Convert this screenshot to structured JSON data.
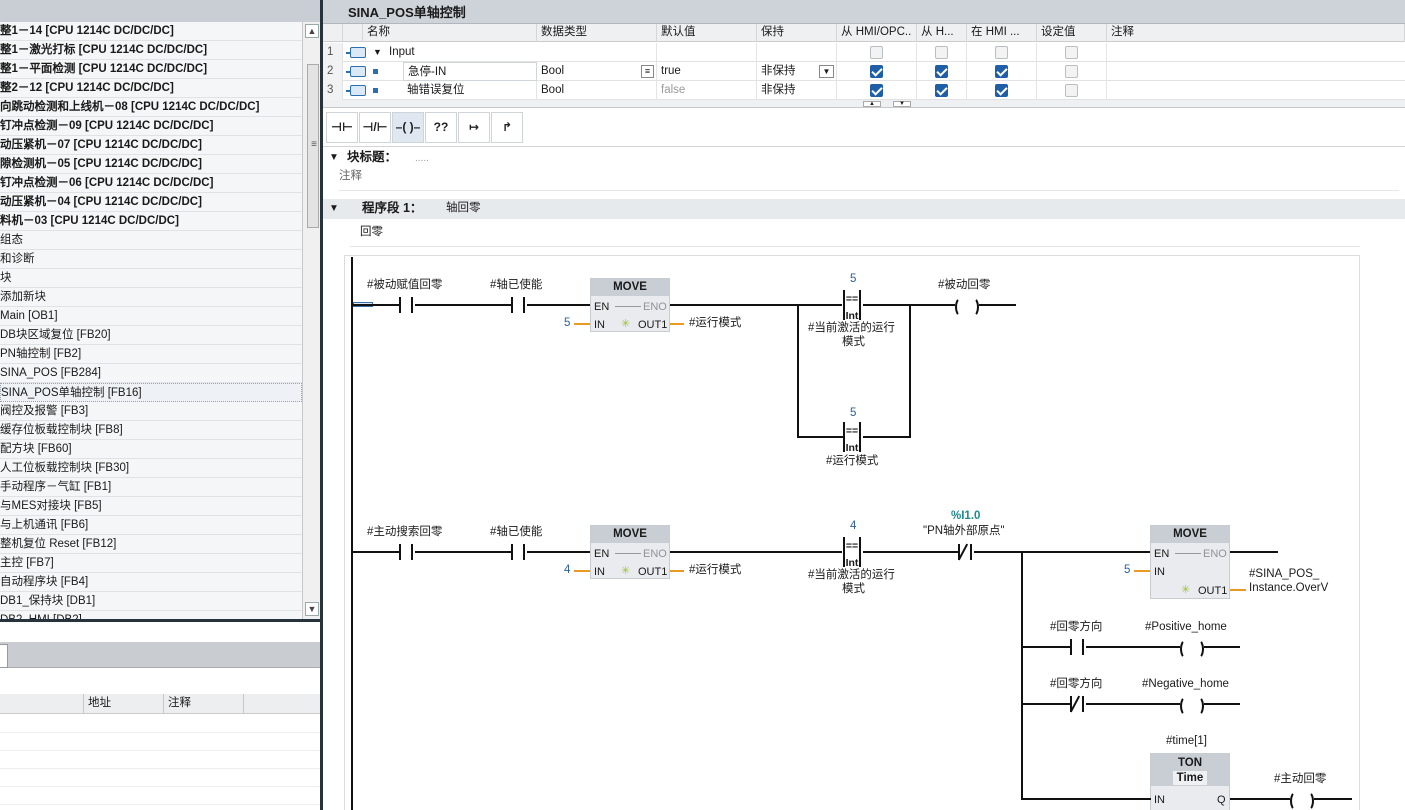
{
  "tree": {
    "items": [
      {
        "label": "整1－14 [CPU 1214C DC/DC/DC]",
        "type": "device"
      },
      {
        "label": "整1－激光打标 [CPU 1214C DC/DC/DC]",
        "type": "device"
      },
      {
        "label": "整1－平面检测 [CPU 1214C DC/DC/DC]",
        "type": "device"
      },
      {
        "label": "整2－12 [CPU 1214C DC/DC/DC]",
        "type": "device"
      },
      {
        "label": "向跳动检测和上线机－08 [CPU 1214C DC/DC/DC]",
        "type": "device"
      },
      {
        "label": "钉冲点检测－09 [CPU 1214C DC/DC/DC]",
        "type": "device"
      },
      {
        "label": "动压紧机－07 [CPU 1214C DC/DC/DC]",
        "type": "device"
      },
      {
        "label": "隙检测机－05 [CPU 1214C DC/DC/DC]",
        "type": "device"
      },
      {
        "label": "钉冲点检测－06 [CPU 1214C DC/DC/DC]",
        "type": "device"
      },
      {
        "label": "动压紧机－04 [CPU 1214C DC/DC/DC]",
        "type": "device"
      },
      {
        "label": "料机－03 [CPU 1214C DC/DC/DC]",
        "type": "device"
      },
      {
        "label": "组态",
        "type": "item"
      },
      {
        "label": "和诊断",
        "type": "item"
      },
      {
        "label": "块",
        "type": "item"
      },
      {
        "label": "添加新块",
        "type": "item"
      },
      {
        "label": "Main [OB1]",
        "type": "item"
      },
      {
        "label": "DB块区域复位 [FB20]",
        "type": "item"
      },
      {
        "label": "PN轴控制 [FB2]",
        "type": "item"
      },
      {
        "label": "SINA_POS [FB284]",
        "type": "item"
      },
      {
        "label": "SINA_POS单轴控制 [FB16]",
        "type": "selected"
      },
      {
        "label": "阀控及报警 [FB3]",
        "type": "item"
      },
      {
        "label": "缓存位板载控制块 [FB8]",
        "type": "item"
      },
      {
        "label": "配方块 [FB60]",
        "type": "item"
      },
      {
        "label": "人工位板载控制块 [FB30]",
        "type": "item"
      },
      {
        "label": "手动程序－气缸 [FB1]",
        "type": "item"
      },
      {
        "label": "与MES对接块 [FB5]",
        "type": "item"
      },
      {
        "label": "与上机通讯 [FB6]",
        "type": "item"
      },
      {
        "label": "整机复位 Reset [FB12]",
        "type": "item"
      },
      {
        "label": "主控 [FB7]",
        "type": "item"
      },
      {
        "label": "自动程序块 [FB4]",
        "type": "item"
      },
      {
        "label": "DB1_保持块 [DB1]",
        "type": "item"
      },
      {
        "label": "DB2_HMI [DB2]",
        "type": "item"
      }
    ]
  },
  "lower": {
    "cols": [
      "地址",
      "注释"
    ]
  },
  "editor": {
    "title": "SINA_POS单轴控制",
    "columns": [
      "名称",
      "数据类型",
      "默认值",
      "保持",
      "从 HMI/OPC..",
      "从 H...",
      "在 HMI ...",
      "设定值",
      "注释"
    ],
    "rows": [
      {
        "num": "1",
        "name": "Input",
        "type": "",
        "default": "",
        "retain": "",
        "c1": false,
        "c2": false,
        "c3": false,
        "c4": false,
        "disabled": true
      },
      {
        "num": "2",
        "name": "急停-IN",
        "type": "Bool",
        "default": "true",
        "retain": "非保持",
        "c1": true,
        "c2": true,
        "c3": true,
        "c4": false,
        "disabled": false
      },
      {
        "num": "3",
        "name": "轴错误复位",
        "type": "Bool",
        "default": "false",
        "retain": "非保持",
        "c1": true,
        "c2": true,
        "c3": true,
        "c4": false,
        "disabled": false
      }
    ],
    "toolbar": [
      "⊣⊢",
      "⊣/⊢",
      "–( )–",
      "??",
      "↦",
      "↱"
    ],
    "block_title_label": "块标题：",
    "block_title_value": ".....",
    "block_comment": "注释",
    "network_label": "程序段 1：",
    "network_title": "轴回零",
    "network_comment": "回零"
  },
  "ladder": {
    "n1": {
      "c1": "#被动赋值回零",
      "c2": "#轴已使能",
      "move_title": "MOVE",
      "en": "EN",
      "eno": "ENO",
      "in": "IN",
      "out1": "OUT1",
      "move_in": "5",
      "move_out": "#运行模式",
      "cmp1_val": "5",
      "cmp_op": "==",
      "cmp_type": "Int",
      "cmp1_label1": "#当前激活的运行",
      "cmp1_label2": "模式",
      "cmp2_val": "5",
      "cmp2_label": "#运行模式",
      "coil": "#被动回零"
    },
    "n2": {
      "c1": "#主动搜索回零",
      "c2": "#轴已使能",
      "move_in": "4",
      "move_out": "#运行模式",
      "cmp_val": "4",
      "cmp_label1": "#当前激活的运行",
      "cmp_label2": "模式",
      "neg_addr": "%I1.0",
      "neg_label": "\"PN轴外部原点\"",
      "move2_in": "5",
      "move2_out1": "#SINA_POS_",
      "move2_out2": "Instance.OverV",
      "dir1": "#回零方向",
      "coil1": "#Positive_home",
      "dir2": "#回零方向",
      "coil2": "#Negative_home",
      "ton_inst": "#time[1]",
      "ton_title": "TON",
      "ton_sub": "Time",
      "ton_in": "IN",
      "ton_q": "Q",
      "coil3": "#主动回零"
    }
  }
}
